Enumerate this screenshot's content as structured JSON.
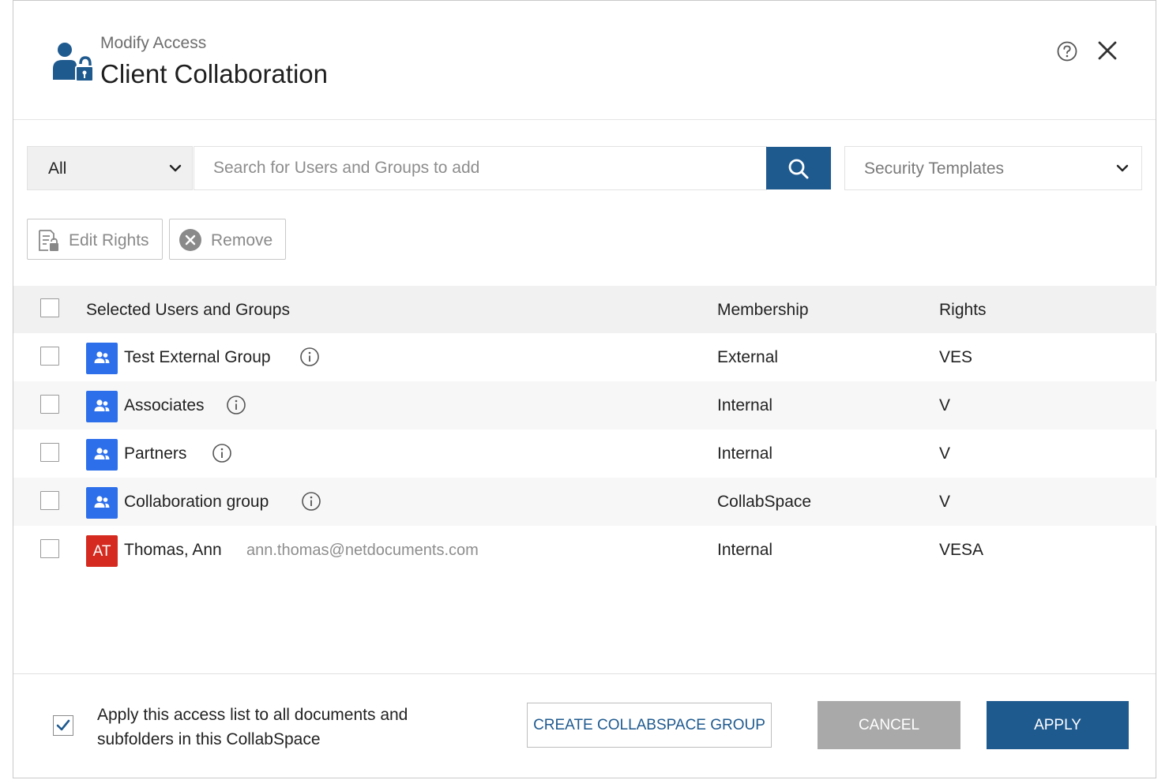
{
  "header": {
    "subtitle": "Modify Access",
    "title": "Client Collaboration"
  },
  "toolbar": {
    "filter_value": "All",
    "search_placeholder": "Search for Users and Groups to add",
    "templates_value": "Security Templates"
  },
  "actions": {
    "edit_rights": "Edit Rights",
    "remove": "Remove"
  },
  "table": {
    "columns": [
      "Selected Users and Groups",
      "Membership",
      "Rights"
    ],
    "rows": [
      {
        "name": "Test External Group",
        "membership": "External",
        "rights": "VES",
        "type": "group"
      },
      {
        "name": "Associates",
        "membership": "Internal",
        "rights": "V",
        "type": "group"
      },
      {
        "name": "Partners",
        "membership": "Internal",
        "rights": "V",
        "type": "group"
      },
      {
        "name": "Collaboration group",
        "membership": "CollabSpace",
        "rights": "V",
        "type": "group"
      },
      {
        "name": "Thomas, Ann",
        "initials": "AT",
        "email": "ann.thomas@netdocuments.com",
        "membership": "Internal",
        "rights": "VESA",
        "type": "user"
      }
    ]
  },
  "footer": {
    "apply_all_text": "Apply this access list to all documents and subfolders in this CollabSpace",
    "apply_all_checked": true,
    "create_button": "CREATE COLLABSPACE GROUP",
    "cancel_button": "CANCEL",
    "apply_button": "APPLY"
  },
  "colors": {
    "primary": "#1f5a8f",
    "group_avatar": "#2d6fea",
    "user_avatar": "#d42a1f",
    "cancel_bg": "#a9a9a9"
  }
}
